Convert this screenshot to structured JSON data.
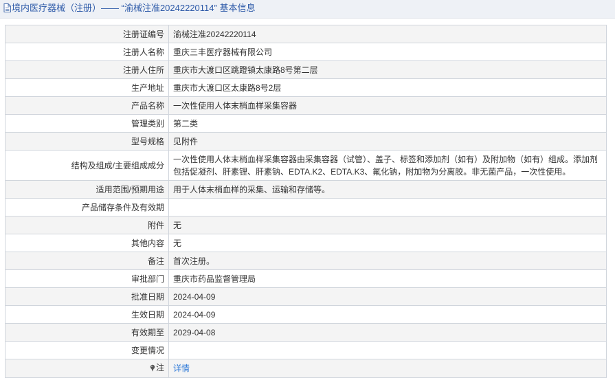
{
  "header": {
    "title": "境内医疗器械（注册）—— “渝械注准20242220114” 基本信息"
  },
  "rows": [
    {
      "label": "注册证编号",
      "value": "渝械注准20242220114"
    },
    {
      "label": "注册人名称",
      "value": "重庆三丰医疗器械有限公司"
    },
    {
      "label": "注册人住所",
      "value": "重庆市大渡口区跳蹬镇太康路8号第二层"
    },
    {
      "label": "生产地址",
      "value": "重庆市大渡口区太康路8号2层"
    },
    {
      "label": "产品名称",
      "value": "一次性使用人体末梢血样采集容器"
    },
    {
      "label": "管理类别",
      "value": "第二类"
    },
    {
      "label": "型号规格",
      "value": "见附件"
    },
    {
      "label": "结构及组成/主要组成成分",
      "value": "一次性使用人体末梢血样采集容器由采集容器（试管）、盖子、标签和添加剂（如有）及附加物（如有）组成。添加剂包括促凝剂、肝素锂、肝素钠、EDTA.K2、EDTA.K3、氟化钠，附加物为分离胶。非无菌产品，一次性使用。"
    },
    {
      "label": "适用范围/预期用途",
      "value": "用于人体末梢血样的采集、运输和存储等。"
    },
    {
      "label": "产品储存条件及有效期",
      "value": ""
    },
    {
      "label": "附件",
      "value": "无"
    },
    {
      "label": "其他内容",
      "value": "无"
    },
    {
      "label": "备注",
      "value": "首次注册。"
    },
    {
      "label": "审批部门",
      "value": "重庆市药品监督管理局"
    },
    {
      "label": "批准日期",
      "value": "2024-04-09"
    },
    {
      "label": "生效日期",
      "value": "2024-04-09"
    },
    {
      "label": "有效期至",
      "value": "2029-04-08"
    },
    {
      "label": "变更情况",
      "value": ""
    }
  ],
  "note": {
    "label": "注",
    "icon": "pin-icon",
    "link_text": "详情",
    "link_color": "#2f7ad8"
  },
  "colors": {
    "header_text": "#2c59a8",
    "header_bg": "#eef1f6",
    "row_shade": "#f4f4f4",
    "border": "#d0d5dc"
  }
}
